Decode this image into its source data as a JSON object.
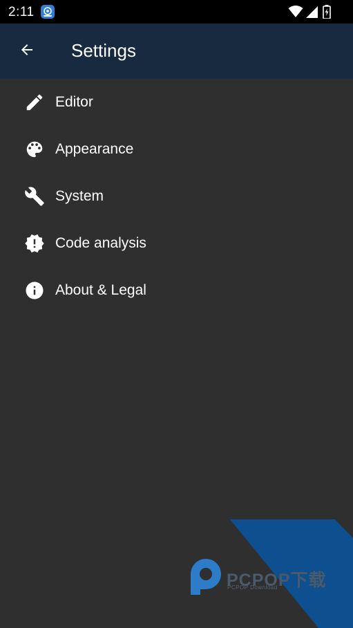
{
  "status_bar": {
    "time": "2:11",
    "icons": [
      "app-notification-icon",
      "wifi-icon",
      "signal-icon",
      "battery-charging-icon"
    ]
  },
  "app_bar": {
    "back_icon": "arrow-left-icon",
    "title": "Settings",
    "background": "#172a40"
  },
  "menu": {
    "items": [
      {
        "label": "Editor",
        "icon": "pencil-icon"
      },
      {
        "label": "Appearance",
        "icon": "palette-icon"
      },
      {
        "label": "System",
        "icon": "wrench-icon"
      },
      {
        "label": "Code analysis",
        "icon": "alert-badge-icon"
      },
      {
        "label": "About & Legal",
        "icon": "info-icon"
      }
    ]
  },
  "watermark": {
    "brand": "PCPOP下载",
    "sub": "PCPOP Download",
    "color": "#0d4f8f"
  },
  "colors": {
    "background": "#2f2f2f",
    "text": "#ffffff"
  }
}
